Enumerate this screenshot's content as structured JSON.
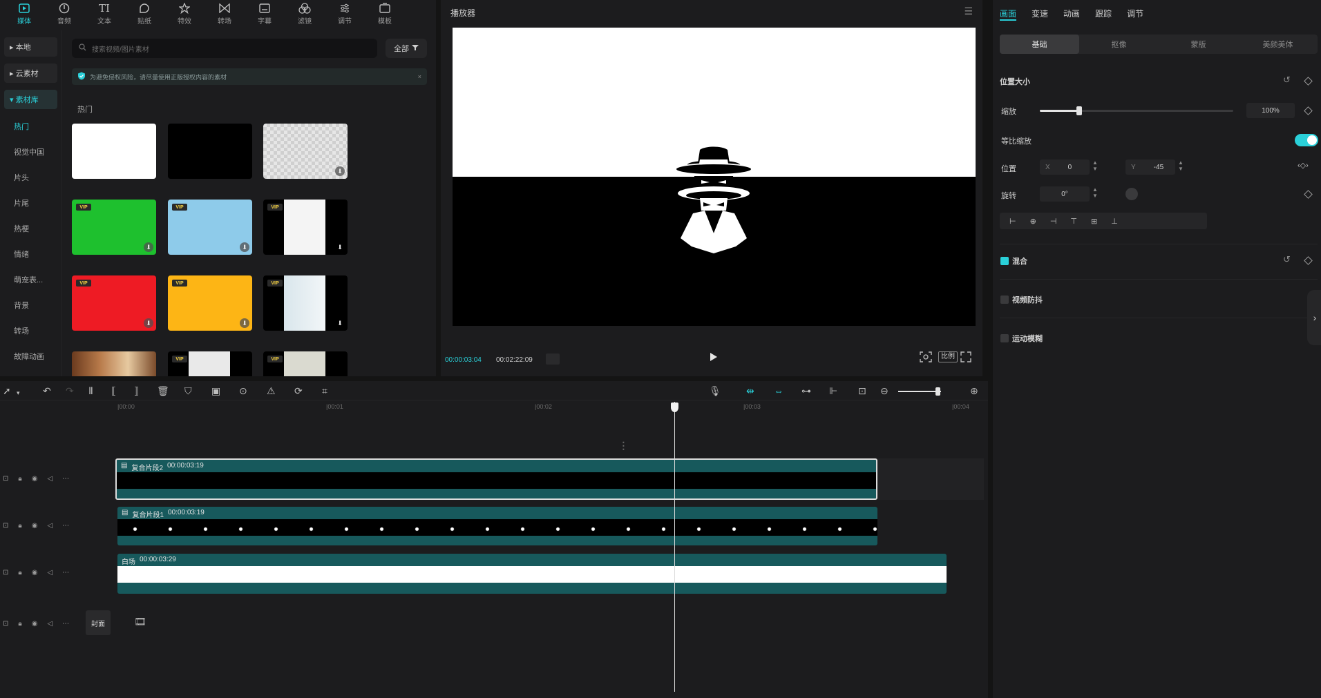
{
  "nav": {
    "tabs": [
      {
        "label": "媒体",
        "icon": "media-icon",
        "active": true
      },
      {
        "label": "音频",
        "icon": "audio-icon"
      },
      {
        "label": "文本",
        "icon": "text-icon",
        "glyph": "TI"
      },
      {
        "label": "贴纸",
        "icon": "sticker-icon"
      },
      {
        "label": "特效",
        "icon": "effects-icon"
      },
      {
        "label": "转场",
        "icon": "transition-icon"
      },
      {
        "label": "字幕",
        "icon": "caption-icon"
      },
      {
        "label": "滤镜",
        "icon": "filter-icon"
      },
      {
        "label": "调节",
        "icon": "adjust-icon"
      },
      {
        "label": "模板",
        "icon": "template-icon"
      }
    ]
  },
  "sidebar": {
    "top": [
      "本地",
      "云素材",
      "素材库"
    ],
    "items": [
      "热门",
      "视觉中国",
      "片头",
      "片尾",
      "热梗",
      "情绪",
      "萌宠表...",
      "背景",
      "转场",
      "故障动画"
    ]
  },
  "content": {
    "search_placeholder": "搜索视频/图片素材",
    "filter_label": "全部",
    "notice": "为避免侵权风险，请尽量使用正版授权内容的素材",
    "section_label": "热门",
    "vip_label": "VIP"
  },
  "player": {
    "title": "播放器",
    "current_time": "00:00:03:04",
    "total_time": "00:02:22:09",
    "ratio_label": "比例"
  },
  "props": {
    "tabs": [
      "画面",
      "变速",
      "动画",
      "跟踪",
      "调节"
    ],
    "subtabs": [
      "基础",
      "抠像",
      "蒙版",
      "美颜美体"
    ],
    "section_position": "位置大小",
    "scale_label": "缩放",
    "scale_value": "100%",
    "uniform_label": "等比缩放",
    "position_label": "位置",
    "pos_x_label": "X",
    "pos_x": "0",
    "pos_y_label": "Y",
    "pos_y": "-45",
    "rotate_label": "旋转",
    "rotate_value": "0°",
    "blend_label": "混合",
    "stabilize_label": "视频防抖",
    "motion_blur_label": "运动模糊"
  },
  "timeline": {
    "ruler": [
      "|00:00",
      "|00:01",
      "|00:02",
      "|00:03",
      "|00:04"
    ],
    "cover_label": "封面",
    "clips": [
      {
        "name": "复合片段2",
        "duration": "00:00:03:19"
      },
      {
        "name": "复合片段1",
        "duration": "00:00:03:19"
      },
      {
        "name": "白场",
        "duration": "00:00:03:29"
      }
    ]
  },
  "colors": {
    "accent": "#2ad0d9",
    "clip": "#17595c",
    "panel": "#1c1c1e"
  }
}
